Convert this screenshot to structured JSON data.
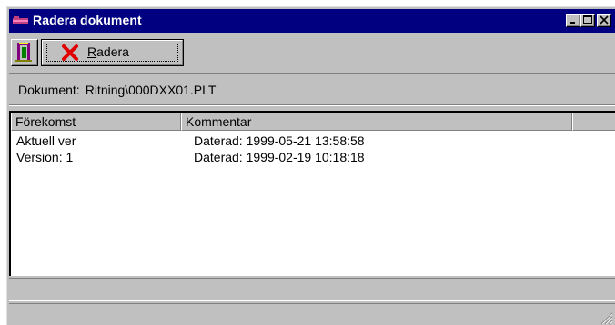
{
  "window": {
    "title": "Radera dokument",
    "controls": [
      "minimize",
      "maximize",
      "close"
    ]
  },
  "toolbar": {
    "exit_icon": "door-exit-icon",
    "delete_button": {
      "icon": "red-x-icon",
      "label_accel": "R",
      "label_rest": "adera"
    }
  },
  "document": {
    "label": "Dokument:",
    "path": "Ritning\\000DXX01.PLT"
  },
  "list": {
    "columns": [
      "Förekomst",
      "Kommentar",
      ""
    ],
    "rows": [
      {
        "occurrence": "Aktuell ver",
        "comment": "Daterad: 1999-05-21 13:58:58"
      },
      {
        "occurrence": "Version: 1",
        "comment": "Daterad: 1999-02-19 10:18:18"
      }
    ]
  },
  "colors": {
    "titlebar": "#000080",
    "face": "#c0c0c0",
    "delete_x": "#e00000"
  }
}
